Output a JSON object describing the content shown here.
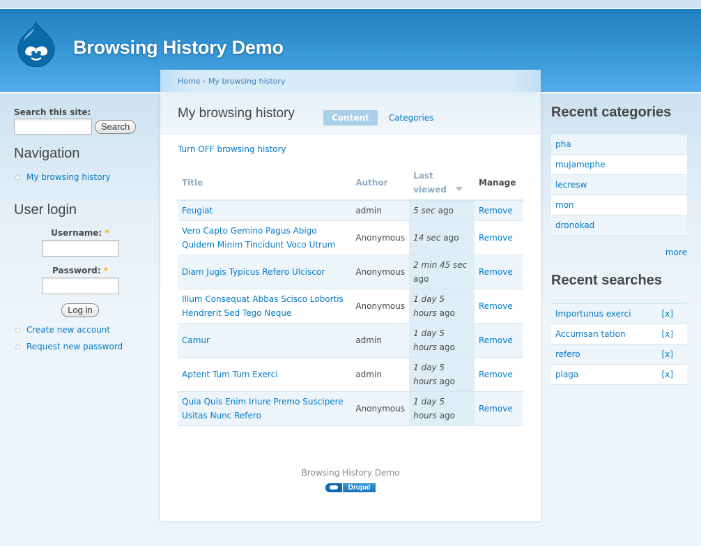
{
  "site": {
    "title": "Browsing History Demo",
    "footer_text": "Browsing History Demo",
    "powered_by_badge": "Drupal",
    "brand_color": "#2280c0",
    "link_color": "#027ac6"
  },
  "breadcrumb": {
    "home": "Home",
    "separator": "›",
    "current": "My browsing history"
  },
  "search_block": {
    "label": "Search this site:",
    "value": "",
    "button": "Search"
  },
  "navigation": {
    "title": "Navigation",
    "items": [
      "My browsing history"
    ]
  },
  "user_login": {
    "title": "User login",
    "username_label": "Username:",
    "password_label": "Password:",
    "required_mark": "*",
    "username_value": "",
    "password_value": "",
    "submit": "Log in",
    "links": [
      "Create new account",
      "Request new password"
    ]
  },
  "main": {
    "page_title": "My browsing history",
    "tabs": [
      {
        "label": "Content",
        "active": true
      },
      {
        "label": "Categories",
        "active": false
      }
    ],
    "toggle_link": "Turn OFF browsing history",
    "table": {
      "headers": {
        "title": "Title",
        "author": "Author",
        "last_viewed": "Last viewed",
        "manage": "Manage"
      },
      "sort_icon": "sort-descending-icon",
      "rows": [
        {
          "title": "Feugiat",
          "author": "admin",
          "time_em": "5 sec",
          "time_suffix": " ago",
          "action": "Remove"
        },
        {
          "title": "Vero Capto Gemino Pagus Abigo Quidem Minim Tincidunt Voco Utrum",
          "author": "Anonymous",
          "time_em": "14 sec",
          "time_suffix": " ago",
          "action": "Remove"
        },
        {
          "title": "Diam Jugis Typicus Refero Ulciscor",
          "author": "Anonymous",
          "time_em": "2 min 45 sec",
          "time_suffix": " ago",
          "action": "Remove"
        },
        {
          "title": "Illum Consequat Abbas Scisco Lobortis Hendrerit Sed Tego Neque",
          "author": "Anonymous",
          "time_em": "1 day 5 hours",
          "time_suffix": " ago",
          "action": "Remove"
        },
        {
          "title": "Camur",
          "author": "admin",
          "time_em": "1 day 5 hours",
          "time_suffix": " ago",
          "action": "Remove"
        },
        {
          "title": "Aptent Tum Tum Exerci",
          "author": "admin",
          "time_em": "1 day 5 hours",
          "time_suffix": " ago",
          "action": "Remove"
        },
        {
          "title": "Quia Quis Enim Iriure Premo Suscipere Usitas Nunc Refero",
          "author": "Anonymous",
          "time_em": "1 day 5 hours",
          "time_suffix": " ago",
          "action": "Remove"
        }
      ]
    }
  },
  "recent_categories": {
    "title": "Recent categories",
    "items": [
      "pha",
      "mujamephe",
      "lecresw",
      "mon",
      "dronokad"
    ],
    "more": "more"
  },
  "recent_searches": {
    "title": "Recent searches",
    "items": [
      {
        "term": "Importunus exerci",
        "remove": "[x]"
      },
      {
        "term": "Accumsan tation",
        "remove": "[x]"
      },
      {
        "term": "refero",
        "remove": "[x]"
      },
      {
        "term": "plaga",
        "remove": "[x]"
      }
    ]
  }
}
